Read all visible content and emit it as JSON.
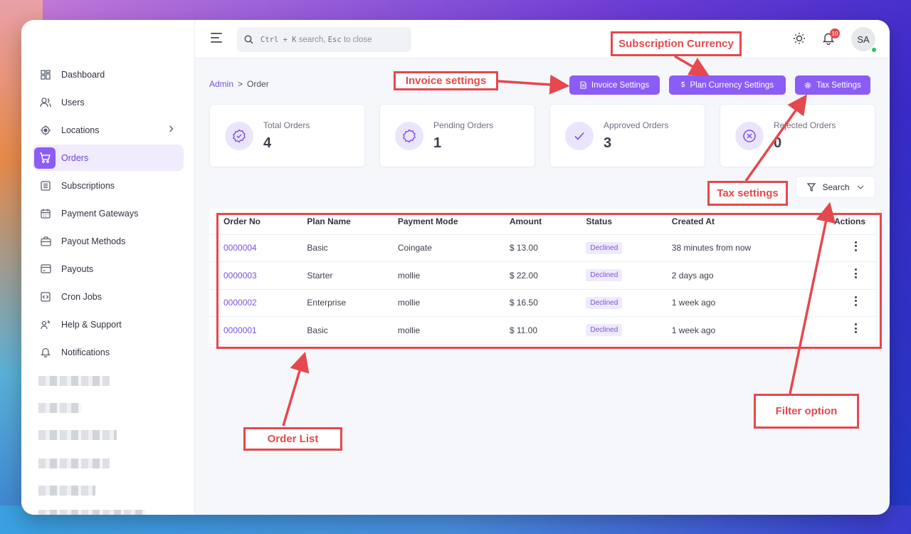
{
  "sidebar": {
    "items": [
      {
        "label": "Dashboard",
        "icon": "dashboard-icon"
      },
      {
        "label": "Users",
        "icon": "users-icon"
      },
      {
        "label": "Locations",
        "icon": "location-icon"
      },
      {
        "label": "Orders",
        "icon": "cart-icon"
      },
      {
        "label": "Subscriptions",
        "icon": "subscriptions-icon"
      },
      {
        "label": "Payment Gateways",
        "icon": "calendar-icon"
      },
      {
        "label": "Payout Methods",
        "icon": "briefcase-icon"
      },
      {
        "label": "Payouts",
        "icon": "credit-card-icon"
      },
      {
        "label": "Cron Jobs",
        "icon": "code-icon"
      },
      {
        "label": "Help & Support",
        "icon": "support-icon"
      },
      {
        "label": "Notifications",
        "icon": "bell-icon"
      }
    ]
  },
  "topbar": {
    "search_key": "Ctrl + K",
    "search_text": "search,",
    "search_key2": "Esc",
    "search_text2": "to close",
    "notification_count": "10",
    "avatar_initials": "SA"
  },
  "breadcrumb": {
    "root": "Admin",
    "sep": ">",
    "current": "Order"
  },
  "actions": {
    "invoice_settings": "Invoice Settings",
    "plan_currency_settings": "Plan Currency Settings",
    "tax_settings": "Tax Settings"
  },
  "stats": [
    {
      "label": "Total Orders",
      "value": "4"
    },
    {
      "label": "Pending Orders",
      "value": "1"
    },
    {
      "label": "Approved Orders",
      "value": "3"
    },
    {
      "label": "Rejected Orders",
      "value": "0"
    }
  ],
  "filter": {
    "label": "Search"
  },
  "table": {
    "headers": [
      "Order No",
      "Plan Name",
      "Payment Mode",
      "Amount",
      "Status",
      "Created At",
      "Actions"
    ],
    "rows": [
      {
        "order_no": "0000004",
        "plan": "Basic",
        "mode": "Coingate",
        "amount": "$ 13.00",
        "status": "Declined",
        "created": "38 minutes from now"
      },
      {
        "order_no": "0000003",
        "plan": "Starter",
        "mode": "mollie",
        "amount": "$ 22.00",
        "status": "Declined",
        "created": "2 days ago"
      },
      {
        "order_no": "0000002",
        "plan": "Enterprise",
        "mode": "mollie",
        "amount": "$ 16.50",
        "status": "Declined",
        "created": "1 week ago"
      },
      {
        "order_no": "0000001",
        "plan": "Basic",
        "mode": "mollie",
        "amount": "$ 11.00",
        "status": "Declined",
        "created": "1 week ago"
      }
    ]
  },
  "annotations": {
    "subscription_currency": "Subscription Currency",
    "invoice_settings": "Invoice settings",
    "tax_settings": "Tax settings",
    "filter_option": "Filter option",
    "order_list": "Order List",
    "color": "#e5484d"
  },
  "colors": {
    "accent": "#8b5cf6",
    "status_bg": "#efeafc"
  }
}
